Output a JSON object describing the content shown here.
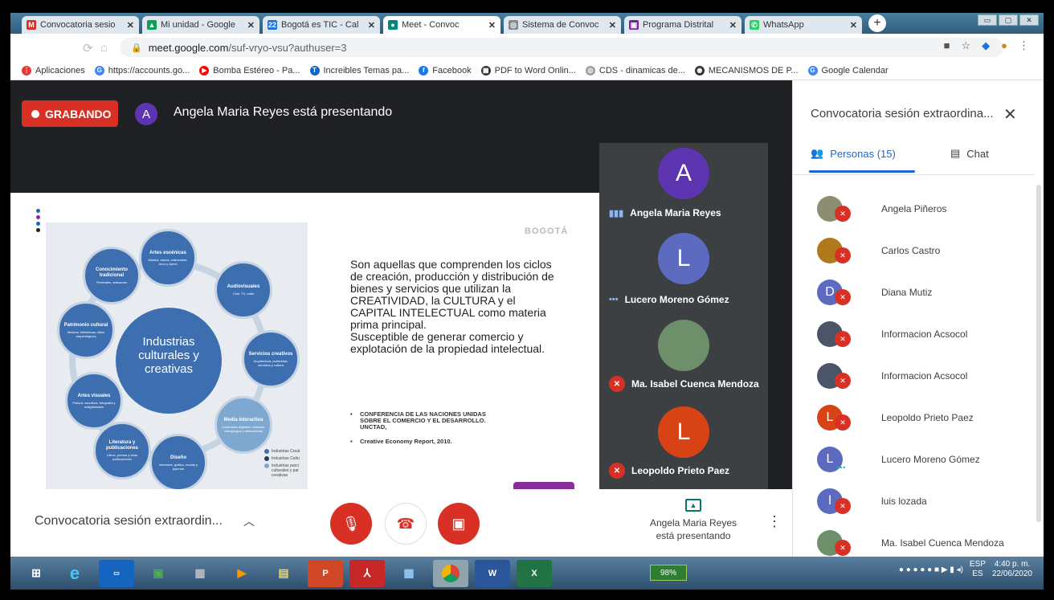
{
  "browser": {
    "tabs": [
      {
        "title": "Convocatoria sesio",
        "color": "#d93025",
        "glyph": "M",
        "active": false
      },
      {
        "title": "Mi unidad - Google",
        "color": "#0f9d58",
        "glyph": "▲",
        "active": false
      },
      {
        "title": "Bogotá es TIC - Cal",
        "color": "#1a73e8",
        "glyph": "22",
        "active": false
      },
      {
        "title": "Meet - Convoc",
        "color": "#00897b",
        "glyph": "●",
        "active": true
      },
      {
        "title": "Sistema de Convoc",
        "color": "#888888",
        "glyph": "◎",
        "active": false
      },
      {
        "title": "Programa Distrital",
        "color": "#7b1fa2",
        "glyph": "▣",
        "active": false
      },
      {
        "title": "WhatsApp",
        "color": "#25d366",
        "glyph": "✆",
        "active": false
      }
    ],
    "url_host": "meet.google.com",
    "url_path": "/suf-vryo-vsu?authuser=3",
    "bookmarks": [
      {
        "label": "Aplicaciones",
        "color": "#e53935",
        "glyph": "⋮"
      },
      {
        "label": "https://accounts.go...",
        "color": "#4285f4",
        "glyph": "G"
      },
      {
        "label": "Bomba Estéreo - Pa...",
        "color": "#ff0000",
        "glyph": "▶"
      },
      {
        "label": "Increibles Temas pa...",
        "color": "#1565c0",
        "glyph": "T"
      },
      {
        "label": "Facebook",
        "color": "#1877f2",
        "glyph": "f"
      },
      {
        "label": "PDF to Word Onlin...",
        "color": "#333333",
        "glyph": "▦"
      },
      {
        "label": "CDS - dinamicas de...",
        "color": "#9e9e9e",
        "glyph": "◎"
      },
      {
        "label": "MECANISMOS DE P...",
        "color": "#333333",
        "glyph": "◉"
      },
      {
        "label": "Google Calendar",
        "color": "#4285f4",
        "glyph": "G"
      }
    ]
  },
  "meet": {
    "recording_label": "GRABANDO",
    "presenter_initial": "A",
    "presenter_line": "Angela Maria Reyes está presentando",
    "slide": {
      "center_label": "Industrias culturales y creativas",
      "nodes": [
        "Artes escénicas",
        "Audiovisuales",
        "Servicios creativos",
        "Media interactiva",
        "Diseño",
        "Literatura y publicaciones",
        "Artes visuales",
        "Patrimonio cultural",
        "Conocimiento tradicional"
      ],
      "node_details": [
        "Música, danza, marionetas, circo y ópera",
        "Cine, TV, radio",
        "Arquitectura, publicidad, servicios y cultura",
        "Contenidos digitales, software, videojuegos y animaciones",
        "Interiores, gráfico, modas y joyerías",
        "Libros, prensa y otras publicaciones",
        "Pintura, escultura, fotografía y antigüedades",
        "Museos, bibliotecas, sitios arqueológicos",
        "Festivales, artesanos"
      ],
      "legend": [
        "Industrias Creat",
        "Industrias Cultu",
        "Industrias parci culturales y par creativas"
      ],
      "body": "Son aquellas que comprenden los ciclos de creación,  producción y distribución de bienes y servicios que utilizan la CREATIVIDAD, la CULTURA y el CAPITAL INTELECTUAL como materia prima principal.",
      "body2": "Susceptible de generar comercio y explotación de la propiedad intelectual.",
      "bullet1": "CONFERENCIA DE LAS NACIONES UNIDAS SOBRE EL COMERCIO Y EL DESARROLLO. UNCTAD,",
      "bullet2": "Creative Economy Report, 2010.",
      "logo": "BOGOTÁ"
    },
    "tiles": [
      {
        "initial": "A",
        "name": "Angela Maria Reyes",
        "color": "#5e35b1",
        "status": "speaking"
      },
      {
        "initial": "L",
        "name": "Lucero Moreno Gómez",
        "color": "#5c6bc0",
        "status": "dots"
      },
      {
        "initial": "",
        "name": "Ma. Isabel Cuenca Mendoza",
        "color": "#6d8f6a",
        "status": "muted"
      },
      {
        "initial": "L",
        "name": "Leopoldo Prieto Paez",
        "color": "#d84315",
        "status": "muted"
      }
    ],
    "meeting_title": "Convocatoria sesión extraordin...",
    "presenting_line1": "Angela Maria Reyes",
    "presenting_line2": "está presentando"
  },
  "panel": {
    "title": "Convocatoria sesión extraordina...",
    "people_tab": "Personas (15)",
    "chat_tab": "Chat",
    "people": [
      {
        "name": "Angela Piñeros",
        "initial": "",
        "color": "#8d8d72",
        "status": "muted"
      },
      {
        "name": "Carlos Castro",
        "initial": "",
        "color": "#b07a1c",
        "status": "muted"
      },
      {
        "name": "Diana Mutiz",
        "initial": "D",
        "color": "#5c6bc0",
        "status": "muted"
      },
      {
        "name": "Informacion Acsocol",
        "initial": "",
        "color": "#4a5568",
        "status": "muted"
      },
      {
        "name": "Informacion Acsocol",
        "initial": "",
        "color": "#4a5568",
        "status": "muted"
      },
      {
        "name": "Leopoldo Prieto Paez",
        "initial": "L",
        "color": "#d84315",
        "status": "muted"
      },
      {
        "name": "Lucero Moreno Gómez",
        "initial": "L",
        "color": "#5c6bc0",
        "status": "dots"
      },
      {
        "name": "luis lozada",
        "initial": "l",
        "color": "#5c6bc0",
        "status": "muted"
      },
      {
        "name": "Ma. Isabel Cuenca Mendoza",
        "initial": "",
        "color": "#6d8f6a",
        "status": "muted"
      }
    ]
  },
  "taskbar": {
    "battery": "98%",
    "lang1": "ESP",
    "lang2": "ES",
    "time": "4:40 p. m.",
    "date": "22/06/2020"
  }
}
